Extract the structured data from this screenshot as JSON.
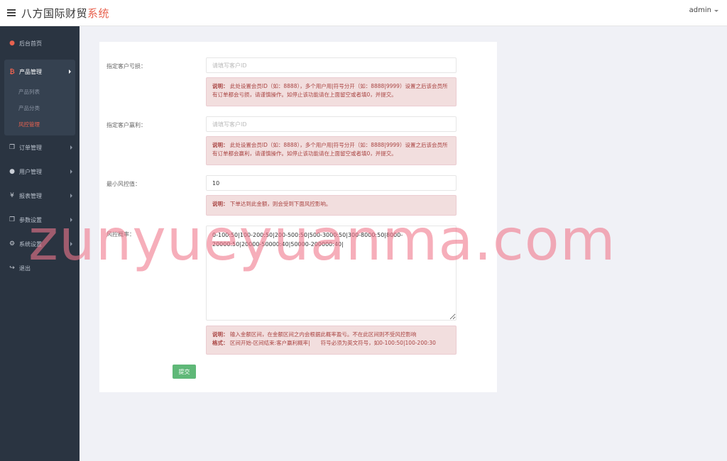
{
  "header": {
    "brand_main": "八方国际财贸",
    "brand_accent": "系统",
    "user": "admin"
  },
  "sidebar": {
    "home": "后台首页",
    "product_group": {
      "label": "产品管理",
      "items": [
        "产品列表",
        "产品分类",
        "风控管理"
      ]
    },
    "items": [
      "订单管理",
      "用户管理",
      "报表管理",
      "参数设置",
      "系统设置",
      "退出"
    ]
  },
  "form": {
    "loss_label": "指定客户亏损：",
    "loss_placeholder": "请填写客户ID",
    "loss_note_title": "说明：",
    "loss_note": "此处设置会员ID（如：8888），多个用户用|符号分开（如：8888|9999）设置之后该会员所有订单都会亏损，请谨慎操作。如停止该功能请在上面留空或者填0，并提交。",
    "win_label": "指定客户赢利：",
    "win_placeholder": "请填写客户ID",
    "win_note_title": "说明：",
    "win_note": "此处设置会员ID（如：8888），多个用户用|符号分开（如：8888|9999）设置之后该会员所有订单都会赢利，请谨慎操作。如停止该功能请在上面留空或者填0，并提交。",
    "min_label": "最小风控值：",
    "min_value": "10",
    "min_note_title": "说明：",
    "min_note": "下单达到此金额，则会受到下面风控影响。",
    "rate_label": "风控概率：",
    "rate_value": "0-100:50|100-200:50|200-500:50|500-3000:50|300-8000:50|8000-20000:50|20000-50000:40|50000-200000:40|",
    "rate_note_title": "说明：",
    "rate_note": "输入金额区间，在金额区间之内会根据此概率盈亏。不在此区间则不受风控影响",
    "rate_format_title": "格式：",
    "rate_format": "区间开始-区间结束:客户赢利概率|　　符号必须为英文符号，如0-100:50|100-200:30",
    "submit": "提交"
  },
  "watermark": "zunyueyuanma.com",
  "colors": {
    "accent": "#e8624f",
    "sidebar": "#2a3441",
    "note_bg": "#f2dede",
    "note_text": "#a94442",
    "submit": "#5fb878"
  }
}
